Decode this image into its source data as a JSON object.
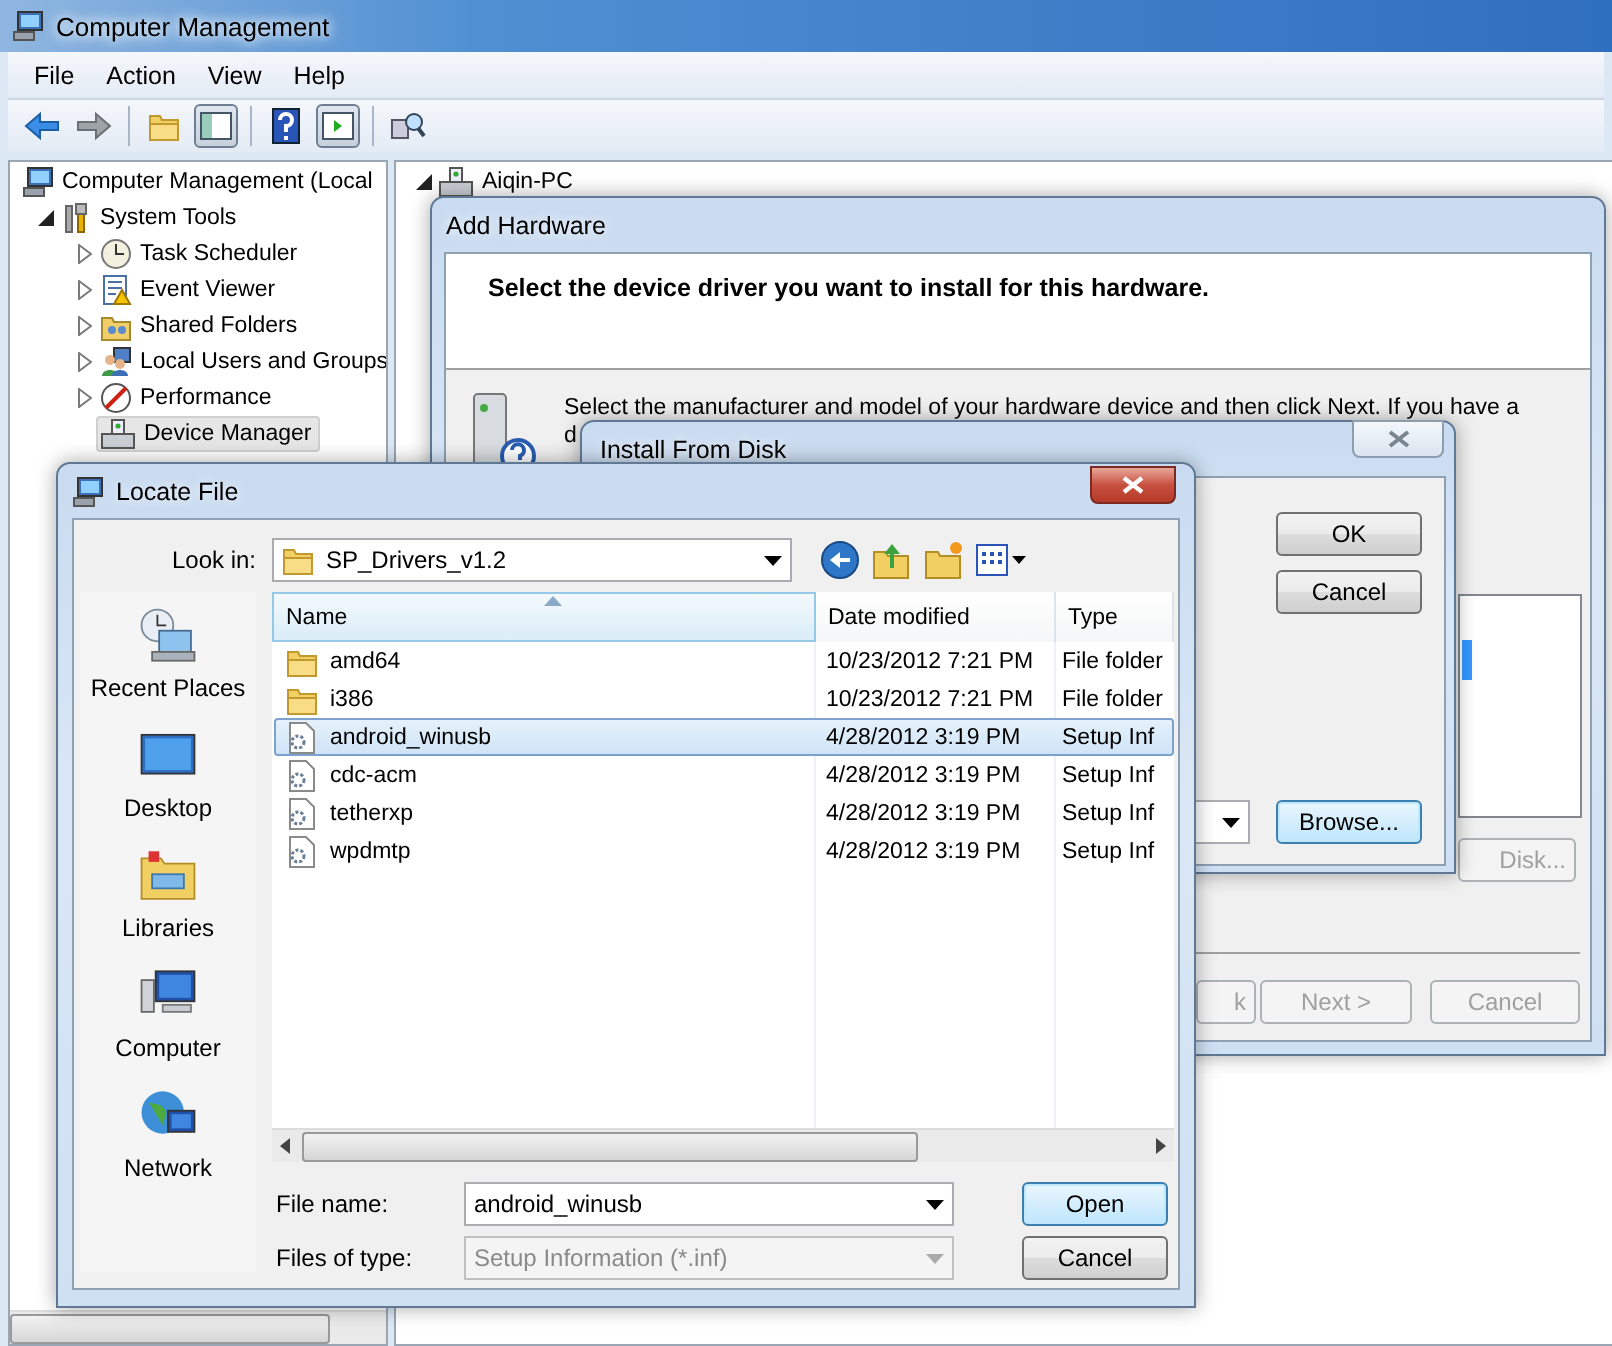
{
  "main_window": {
    "title": "Computer Management",
    "menu": [
      "File",
      "Action",
      "View",
      "Help"
    ],
    "tree": {
      "root": "Computer Management (Local",
      "items": [
        {
          "label": "System Tools",
          "kind": "node",
          "expanded": true,
          "selected": false,
          "children": [
            {
              "label": "Task Scheduler",
              "kind": "node",
              "expanded": false,
              "selected": false
            },
            {
              "label": "Event Viewer",
              "kind": "node",
              "expanded": false,
              "selected": false
            },
            {
              "label": "Shared Folders",
              "kind": "node",
              "expanded": false,
              "selected": false
            },
            {
              "label": "Local Users and Groups",
              "kind": "node",
              "expanded": false,
              "selected": false
            },
            {
              "label": "Performance",
              "kind": "node",
              "expanded": false,
              "selected": false
            },
            {
              "label": "Device Manager",
              "kind": "leaf",
              "selected": true
            }
          ]
        }
      ]
    },
    "right_pane": {
      "node": "Aiqin-PC",
      "expanded": true
    }
  },
  "add_hardware": {
    "title": "Add Hardware",
    "heading": "Select the device driver you want to install for this hardware.",
    "instruction": [
      "Select the manufacturer and model of your hardware device and then click Next. If you have a",
      "d"
    ],
    "disk_button": {
      "label": "Disk...",
      "disabled": true
    },
    "buttons": [
      {
        "label": "k",
        "disabled": true
      },
      {
        "label": "Next >",
        "disabled": true
      },
      {
        "label": "Cancel",
        "disabled": true
      }
    ]
  },
  "install_from_disk": {
    "title": "Install From Disk",
    "buttons": [
      {
        "label": "OK",
        "focused": false
      },
      {
        "label": "Cancel",
        "focused": false
      }
    ],
    "browse_button": {
      "label": "Browse...",
      "focused": true
    }
  },
  "locate_file": {
    "title": "Locate File",
    "look_in_label": "Look in:",
    "look_in": "SP_Drivers_v1.2",
    "places": [
      "Recent Places",
      "Desktop",
      "Libraries",
      "Computer",
      "Network"
    ],
    "columns": [
      {
        "label": "Name",
        "sorted": true
      },
      {
        "label": "Date modified",
        "sorted": false
      },
      {
        "label": "Type",
        "sorted": false
      }
    ],
    "rows": [
      {
        "name": "amd64",
        "date": "10/23/2012 7:21 PM",
        "type": "File folder",
        "kind": "folder",
        "selected": false
      },
      {
        "name": "i386",
        "date": "10/23/2012 7:21 PM",
        "type": "File folder",
        "kind": "folder",
        "selected": false
      },
      {
        "name": "android_winusb",
        "date": "4/28/2012 3:19 PM",
        "type": "Setup Inf",
        "kind": "setup",
        "selected": true
      },
      {
        "name": "cdc-acm",
        "date": "4/28/2012 3:19 PM",
        "type": "Setup Inf",
        "kind": "setup",
        "selected": false
      },
      {
        "name": "tetherxp",
        "date": "4/28/2012 3:19 PM",
        "type": "Setup Inf",
        "kind": "setup",
        "selected": false
      },
      {
        "name": "wpdmtp",
        "date": "4/28/2012 3:19 PM",
        "type": "Setup Inf",
        "kind": "setup",
        "selected": false
      }
    ],
    "file_name_label": "File name:",
    "file_name": "android_winusb",
    "file_type_label": "Files of type:",
    "file_type": "Setup Information (*.inf)",
    "file_type_disabled": true,
    "buttons": [
      {
        "label": "Open",
        "default": true
      },
      {
        "label": "Cancel",
        "default": false
      }
    ]
  }
}
